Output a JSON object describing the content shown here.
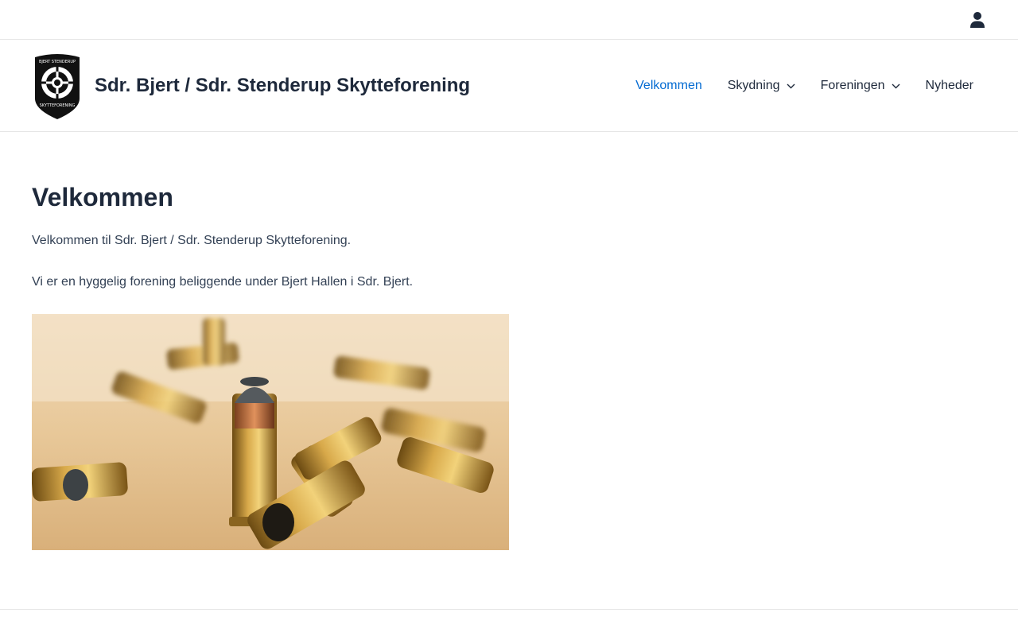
{
  "topbar": {
    "account_icon": "user-icon"
  },
  "header": {
    "logo_icon": "club-shield-logo",
    "logo_text_top": "BJERT STENDERUP",
    "logo_text_bottom": "SKYTTEFORENING",
    "site_title": "Sdr. Bjert / Sdr. Stenderup Skytteforening"
  },
  "nav": {
    "items": [
      {
        "label": "Velkommen",
        "active": true,
        "has_submenu": false
      },
      {
        "label": "Skydning",
        "active": false,
        "has_submenu": true
      },
      {
        "label": "Foreningen",
        "active": false,
        "has_submenu": true
      },
      {
        "label": "Nyheder",
        "active": false,
        "has_submenu": false
      }
    ],
    "active_color": "#046bd2",
    "chevron_icon": "chevron-down-icon"
  },
  "main": {
    "title": "Velkommen",
    "paragraphs": [
      "Velkommen til Sdr. Bjert / Sdr. Stenderup Skytteforening.",
      "Vi er en hyggelig forening beliggende under Bjert Hallen i Sdr. Bjert."
    ],
    "image_subject": "bullets-photo"
  },
  "colors": {
    "heading": "#1e293b",
    "text": "#334155",
    "border": "#e6e6e6"
  }
}
